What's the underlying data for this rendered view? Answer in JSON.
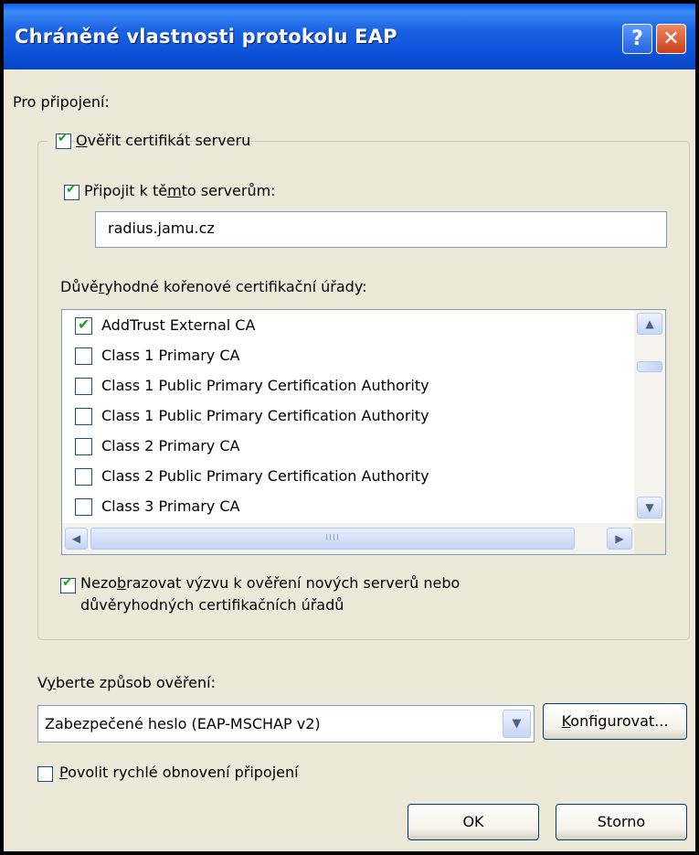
{
  "window": {
    "title": "Chráněné vlastnosti protokolu EAP",
    "help": "?",
    "close": "✕"
  },
  "connection": {
    "label": "Pro připojení:",
    "verify_cert": {
      "label_mnemonic": "O",
      "label_rest": "věřit certifikát serveru",
      "checked": true
    },
    "connect_to": {
      "label_pre": "Připojit k tě",
      "label_mnemonic": "m",
      "label_post": "to serverům:",
      "checked": true,
      "value": "radius.jamu.cz"
    },
    "trusted_ca": {
      "label_pre": "Důvě",
      "label_mnemonic": "r",
      "label_post": "yhodné kořenové certifikační úřady:",
      "items": [
        {
          "label": "AddTrust External CA",
          "checked": true
        },
        {
          "label": "Class 1 Primary CA",
          "checked": false
        },
        {
          "label": "Class 1 Public Primary Certification Authority",
          "checked": false
        },
        {
          "label": "Class 1 Public Primary Certification Authority",
          "checked": false
        },
        {
          "label": "Class 2 Primary CA",
          "checked": false
        },
        {
          "label": "Class 2 Public Primary Certification Authority",
          "checked": false
        },
        {
          "label": "Class 3 Primary CA",
          "checked": false
        }
      ],
      "scroll_up": "▲",
      "scroll_down": "▼",
      "scroll_left": "◀",
      "scroll_right": "▶",
      "thumb_grip": "IIII"
    },
    "no_prompt": {
      "line1_pre": "Nezo",
      "line1_mnemonic": "b",
      "line1_post": "razovat výzvu k ověření nových serverů nebo",
      "line2": "důvěryhodných certifikačních úřadů",
      "checked": true
    }
  },
  "auth": {
    "label_pre": "V",
    "label_mnemonic": "y",
    "label_post": "berte způsob ověření:",
    "selected": "Zabezpečené heslo (EAP-MSCHAP v2)",
    "dropdown": "▼",
    "configure_mnemonic": "K",
    "configure_rest": "onfigurovat..."
  },
  "fast_reconnect": {
    "label_mnemonic": "P",
    "label_rest": "ovolit rychlé obnovení připojení",
    "checked": false
  },
  "buttons": {
    "ok": "OK",
    "cancel": "Storno"
  },
  "colors": {
    "titlebar": "#0a4fd6",
    "face": "#ece9d8",
    "check": "#21a121",
    "close": "#c8401a"
  }
}
